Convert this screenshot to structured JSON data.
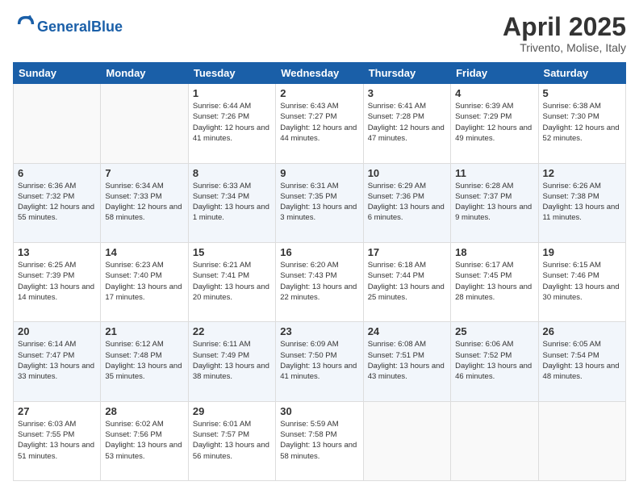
{
  "header": {
    "logo_general": "General",
    "logo_blue": "Blue",
    "title": "April 2025",
    "subtitle": "Trivento, Molise, Italy"
  },
  "days_of_week": [
    "Sunday",
    "Monday",
    "Tuesday",
    "Wednesday",
    "Thursday",
    "Friday",
    "Saturday"
  ],
  "weeks": [
    [
      {
        "day": "",
        "sunrise": "",
        "sunset": "",
        "daylight": ""
      },
      {
        "day": "",
        "sunrise": "",
        "sunset": "",
        "daylight": ""
      },
      {
        "day": "1",
        "sunrise": "Sunrise: 6:44 AM",
        "sunset": "Sunset: 7:26 PM",
        "daylight": "Daylight: 12 hours and 41 minutes."
      },
      {
        "day": "2",
        "sunrise": "Sunrise: 6:43 AM",
        "sunset": "Sunset: 7:27 PM",
        "daylight": "Daylight: 12 hours and 44 minutes."
      },
      {
        "day": "3",
        "sunrise": "Sunrise: 6:41 AM",
        "sunset": "Sunset: 7:28 PM",
        "daylight": "Daylight: 12 hours and 47 minutes."
      },
      {
        "day": "4",
        "sunrise": "Sunrise: 6:39 AM",
        "sunset": "Sunset: 7:29 PM",
        "daylight": "Daylight: 12 hours and 49 minutes."
      },
      {
        "day": "5",
        "sunrise": "Sunrise: 6:38 AM",
        "sunset": "Sunset: 7:30 PM",
        "daylight": "Daylight: 12 hours and 52 minutes."
      }
    ],
    [
      {
        "day": "6",
        "sunrise": "Sunrise: 6:36 AM",
        "sunset": "Sunset: 7:32 PM",
        "daylight": "Daylight: 12 hours and 55 minutes."
      },
      {
        "day": "7",
        "sunrise": "Sunrise: 6:34 AM",
        "sunset": "Sunset: 7:33 PM",
        "daylight": "Daylight: 12 hours and 58 minutes."
      },
      {
        "day": "8",
        "sunrise": "Sunrise: 6:33 AM",
        "sunset": "Sunset: 7:34 PM",
        "daylight": "Daylight: 13 hours and 1 minute."
      },
      {
        "day": "9",
        "sunrise": "Sunrise: 6:31 AM",
        "sunset": "Sunset: 7:35 PM",
        "daylight": "Daylight: 13 hours and 3 minutes."
      },
      {
        "day": "10",
        "sunrise": "Sunrise: 6:29 AM",
        "sunset": "Sunset: 7:36 PM",
        "daylight": "Daylight: 13 hours and 6 minutes."
      },
      {
        "day": "11",
        "sunrise": "Sunrise: 6:28 AM",
        "sunset": "Sunset: 7:37 PM",
        "daylight": "Daylight: 13 hours and 9 minutes."
      },
      {
        "day": "12",
        "sunrise": "Sunrise: 6:26 AM",
        "sunset": "Sunset: 7:38 PM",
        "daylight": "Daylight: 13 hours and 11 minutes."
      }
    ],
    [
      {
        "day": "13",
        "sunrise": "Sunrise: 6:25 AM",
        "sunset": "Sunset: 7:39 PM",
        "daylight": "Daylight: 13 hours and 14 minutes."
      },
      {
        "day": "14",
        "sunrise": "Sunrise: 6:23 AM",
        "sunset": "Sunset: 7:40 PM",
        "daylight": "Daylight: 13 hours and 17 minutes."
      },
      {
        "day": "15",
        "sunrise": "Sunrise: 6:21 AM",
        "sunset": "Sunset: 7:41 PM",
        "daylight": "Daylight: 13 hours and 20 minutes."
      },
      {
        "day": "16",
        "sunrise": "Sunrise: 6:20 AM",
        "sunset": "Sunset: 7:43 PM",
        "daylight": "Daylight: 13 hours and 22 minutes."
      },
      {
        "day": "17",
        "sunrise": "Sunrise: 6:18 AM",
        "sunset": "Sunset: 7:44 PM",
        "daylight": "Daylight: 13 hours and 25 minutes."
      },
      {
        "day": "18",
        "sunrise": "Sunrise: 6:17 AM",
        "sunset": "Sunset: 7:45 PM",
        "daylight": "Daylight: 13 hours and 28 minutes."
      },
      {
        "day": "19",
        "sunrise": "Sunrise: 6:15 AM",
        "sunset": "Sunset: 7:46 PM",
        "daylight": "Daylight: 13 hours and 30 minutes."
      }
    ],
    [
      {
        "day": "20",
        "sunrise": "Sunrise: 6:14 AM",
        "sunset": "Sunset: 7:47 PM",
        "daylight": "Daylight: 13 hours and 33 minutes."
      },
      {
        "day": "21",
        "sunrise": "Sunrise: 6:12 AM",
        "sunset": "Sunset: 7:48 PM",
        "daylight": "Daylight: 13 hours and 35 minutes."
      },
      {
        "day": "22",
        "sunrise": "Sunrise: 6:11 AM",
        "sunset": "Sunset: 7:49 PM",
        "daylight": "Daylight: 13 hours and 38 minutes."
      },
      {
        "day": "23",
        "sunrise": "Sunrise: 6:09 AM",
        "sunset": "Sunset: 7:50 PM",
        "daylight": "Daylight: 13 hours and 41 minutes."
      },
      {
        "day": "24",
        "sunrise": "Sunrise: 6:08 AM",
        "sunset": "Sunset: 7:51 PM",
        "daylight": "Daylight: 13 hours and 43 minutes."
      },
      {
        "day": "25",
        "sunrise": "Sunrise: 6:06 AM",
        "sunset": "Sunset: 7:52 PM",
        "daylight": "Daylight: 13 hours and 46 minutes."
      },
      {
        "day": "26",
        "sunrise": "Sunrise: 6:05 AM",
        "sunset": "Sunset: 7:54 PM",
        "daylight": "Daylight: 13 hours and 48 minutes."
      }
    ],
    [
      {
        "day": "27",
        "sunrise": "Sunrise: 6:03 AM",
        "sunset": "Sunset: 7:55 PM",
        "daylight": "Daylight: 13 hours and 51 minutes."
      },
      {
        "day": "28",
        "sunrise": "Sunrise: 6:02 AM",
        "sunset": "Sunset: 7:56 PM",
        "daylight": "Daylight: 13 hours and 53 minutes."
      },
      {
        "day": "29",
        "sunrise": "Sunrise: 6:01 AM",
        "sunset": "Sunset: 7:57 PM",
        "daylight": "Daylight: 13 hours and 56 minutes."
      },
      {
        "day": "30",
        "sunrise": "Sunrise: 5:59 AM",
        "sunset": "Sunset: 7:58 PM",
        "daylight": "Daylight: 13 hours and 58 minutes."
      },
      {
        "day": "",
        "sunrise": "",
        "sunset": "",
        "daylight": ""
      },
      {
        "day": "",
        "sunrise": "",
        "sunset": "",
        "daylight": ""
      },
      {
        "day": "",
        "sunrise": "",
        "sunset": "",
        "daylight": ""
      }
    ]
  ]
}
